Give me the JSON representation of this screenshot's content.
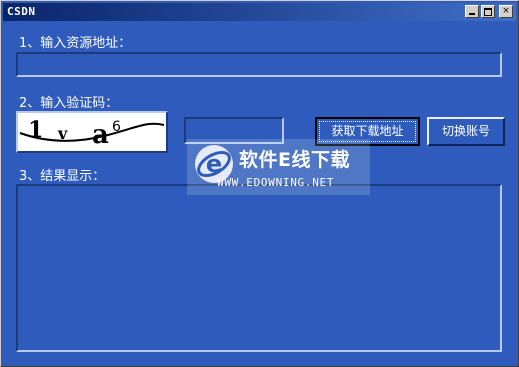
{
  "window": {
    "title": "CSDN",
    "controls": {
      "minimize": "minimize-icon",
      "maximize": "maximize-icon",
      "close": "×"
    }
  },
  "step1": {
    "label": "1、输入资源地址：",
    "value": ""
  },
  "step2": {
    "label": "2、输入验证码：",
    "captcha_text": "1 v a 6",
    "captcha_glyphs": [
      "1",
      "v",
      "a",
      "6"
    ],
    "code_value": ""
  },
  "buttons": {
    "get_download": "获取下载地址",
    "switch_account": "切换账号"
  },
  "step3": {
    "label": "3、结果显示：",
    "value": ""
  },
  "watermark": {
    "title": "软件E线下载",
    "url": "WWW.EDOWNING.NET",
    "logo": "e-logo-icon"
  },
  "colors": {
    "window_bg": "#2f5cbc",
    "titlebar_start": "#0a246a",
    "titlebar_end": "#3f6fc8",
    "text": "#ffffff"
  }
}
